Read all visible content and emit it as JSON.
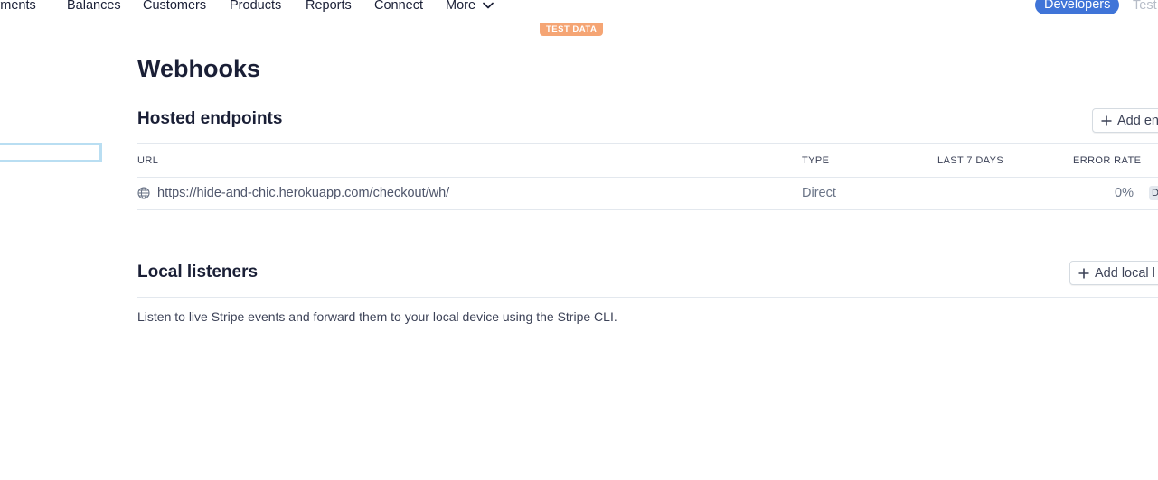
{
  "nav": {
    "items": [
      "yments",
      "Balances",
      "Customers",
      "Products",
      "Reports",
      "Connect"
    ],
    "more_label": "More",
    "developers_label": "Developers",
    "test_mode_label": "Test"
  },
  "badge": {
    "label": "TEST DATA"
  },
  "page": {
    "title": "Webhooks"
  },
  "hosted": {
    "title": "Hosted endpoints",
    "add_button": "Add en",
    "columns": [
      "URL",
      "TYPE",
      "LAST 7 DAYS",
      "ERROR RATE"
    ],
    "rows": [
      {
        "url": "https://hide-and-chic.herokuapp.com/checkout/wh/",
        "type": "Direct",
        "last7": "",
        "error_rate": "0%",
        "status_chip": "D"
      }
    ]
  },
  "local": {
    "title": "Local listeners",
    "add_button": "Add local l",
    "description": "Listen to live Stripe events and forward them to your local device using the Stripe CLI."
  },
  "colors": {
    "accent_blue": "#3f74d8",
    "test_orange": "#f5a574",
    "focus_ring": "#b9def2",
    "text_dark": "#1a1f36",
    "border": "#e3e8ee"
  },
  "icons": {
    "more": "chevron-down-icon",
    "add": "plus-icon",
    "url": "globe-icon"
  }
}
